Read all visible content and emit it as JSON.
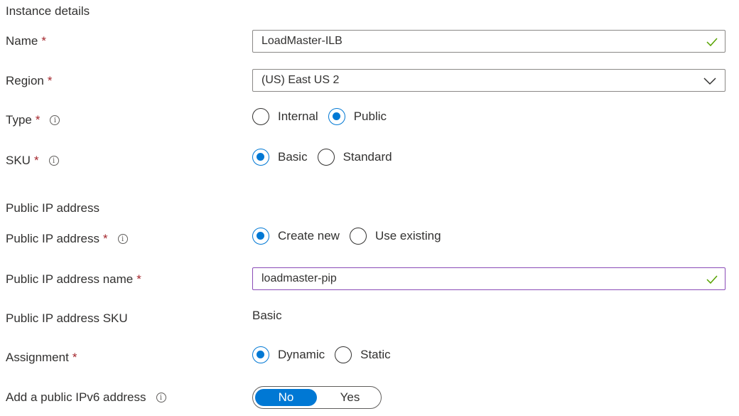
{
  "sections": {
    "instance_details": "Instance details",
    "public_ip": "Public IP address"
  },
  "name": {
    "label": "Name",
    "required": "*",
    "value": "LoadMaster-ILB"
  },
  "region": {
    "label": "Region",
    "required": "*",
    "value": "(US) East US 2"
  },
  "type": {
    "label": "Type",
    "required": "*",
    "info": "i",
    "options": [
      "Internal",
      "Public"
    ],
    "selected": "Public"
  },
  "sku": {
    "label": "SKU",
    "required": "*",
    "info": "i",
    "options": [
      "Basic",
      "Standard"
    ],
    "selected": "Basic"
  },
  "public_ip_address": {
    "label": "Public IP address",
    "required": "*",
    "info": "i",
    "options": [
      "Create new",
      "Use existing"
    ],
    "selected": "Create new"
  },
  "public_ip_name": {
    "label": "Public IP address name",
    "required": "*",
    "value": "loadmaster-pip"
  },
  "public_ip_sku": {
    "label": "Public IP address SKU",
    "value": "Basic"
  },
  "assignment": {
    "label": "Assignment",
    "required": "*",
    "options": [
      "Dynamic",
      "Static"
    ],
    "selected": "Dynamic"
  },
  "ipv6": {
    "label": "Add a public IPv6 address",
    "info": "i",
    "options": [
      "No",
      "Yes"
    ],
    "selected": "No"
  },
  "colors": {
    "accent": "#0078d4",
    "valid": "#57a300",
    "required": "#a4262c",
    "focus_border": "#8a4bb7"
  },
  "icons": {
    "valid": "checkmark-icon",
    "dropdown": "chevron-down-icon",
    "info": "info-icon"
  }
}
